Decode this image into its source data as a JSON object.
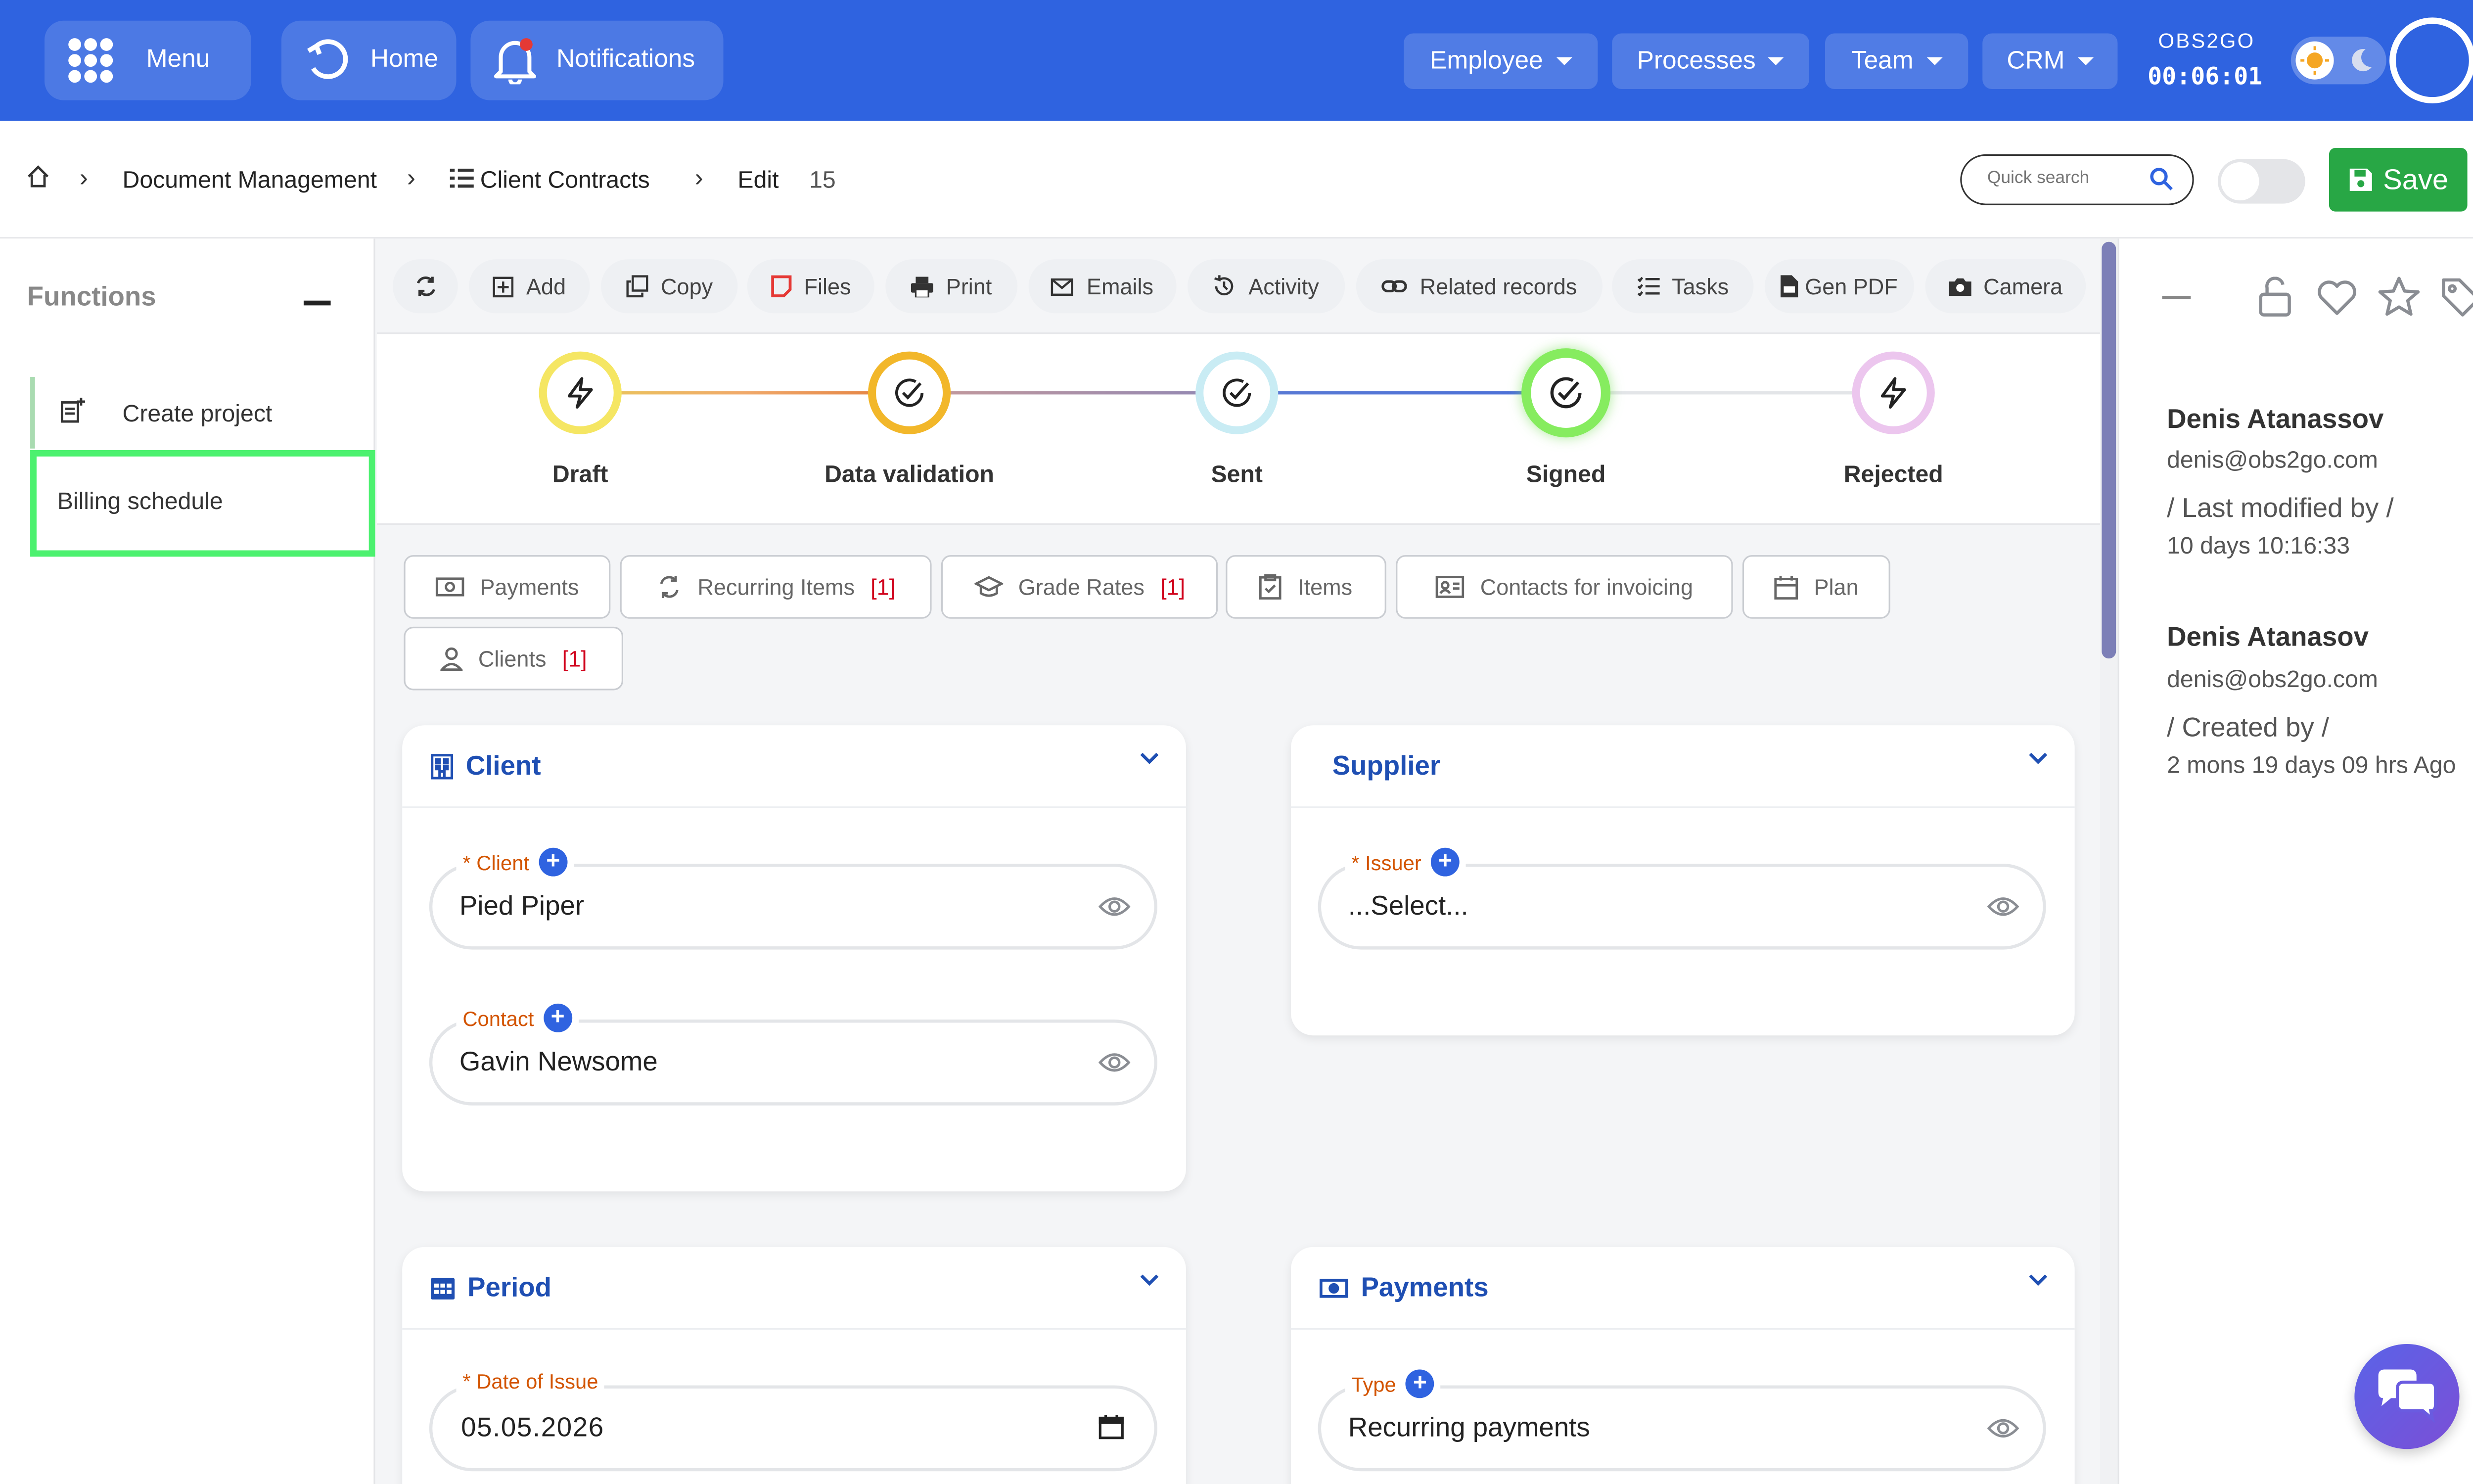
{
  "topbar": {
    "menu_label": "Menu",
    "home_label": "Home",
    "notifications_label": "Notifications",
    "dropdowns": [
      "Employee",
      "Processes",
      "Team",
      "CRM"
    ],
    "brand": "OBS2GO",
    "timer": "00:06:01",
    "accent": "#2f63e0"
  },
  "breadcrumb": {
    "section": "Document Management",
    "module": "Client Contracts",
    "action": "Edit",
    "record_id": "15",
    "search_placeholder": "Quick search",
    "save_label": "Save",
    "save_color": "#28a745"
  },
  "functions": {
    "title": "Functions",
    "items": [
      "Create project",
      "Billing schedule"
    ]
  },
  "toolbar": {
    "buttons": [
      "Add",
      "Copy",
      "Files",
      "Print",
      "Emails",
      "Activity",
      "Related records",
      "Tasks",
      "Gen PDF",
      "Camera"
    ]
  },
  "stages": [
    {
      "label": "Draft",
      "color": "#f5e663"
    },
    {
      "label": "Data validation",
      "color": "#f2b72a"
    },
    {
      "label": "Sent",
      "color": "#c9ecf4"
    },
    {
      "label": "Signed",
      "color": "#86ec5f"
    },
    {
      "label": "Rejected",
      "color": "#ecc6ee"
    }
  ],
  "tabs": [
    {
      "label": "Payments",
      "count": ""
    },
    {
      "label": "Recurring Items",
      "count": "[1]"
    },
    {
      "label": "Grade Rates",
      "count": "[1]"
    },
    {
      "label": "Items",
      "count": ""
    },
    {
      "label": "Contacts for invoicing",
      "count": ""
    },
    {
      "label": "Plan",
      "count": ""
    },
    {
      "label": "Clients",
      "count": "[1]"
    }
  ],
  "client_card": {
    "title": "Client",
    "client_label": "* Client",
    "client_value": "Pied Piper",
    "contact_label": "Contact",
    "contact_value": "Gavin Newsome"
  },
  "supplier_card": {
    "title": "Supplier",
    "issuer_label": "* Issuer",
    "issuer_value": "...Select..."
  },
  "period_card": {
    "title": "Period",
    "date_label": "* Date of Issue",
    "date_value": "05.05.2026"
  },
  "payments_card": {
    "title": "Payments",
    "type_label": "Type",
    "type_value": "Recurring payments"
  },
  "audit": {
    "modified_name": "Denis Atanassov",
    "modified_email": "denis@obs2go.com",
    "modified_caption": "/ Last modified by /",
    "modified_time": "10 days 10:16:33",
    "created_name": "Denis Atanasov",
    "created_email": "denis@obs2go.com",
    "created_caption": "/ Created by /",
    "created_time": "2 mons 19 days 09 hrs Ago"
  }
}
